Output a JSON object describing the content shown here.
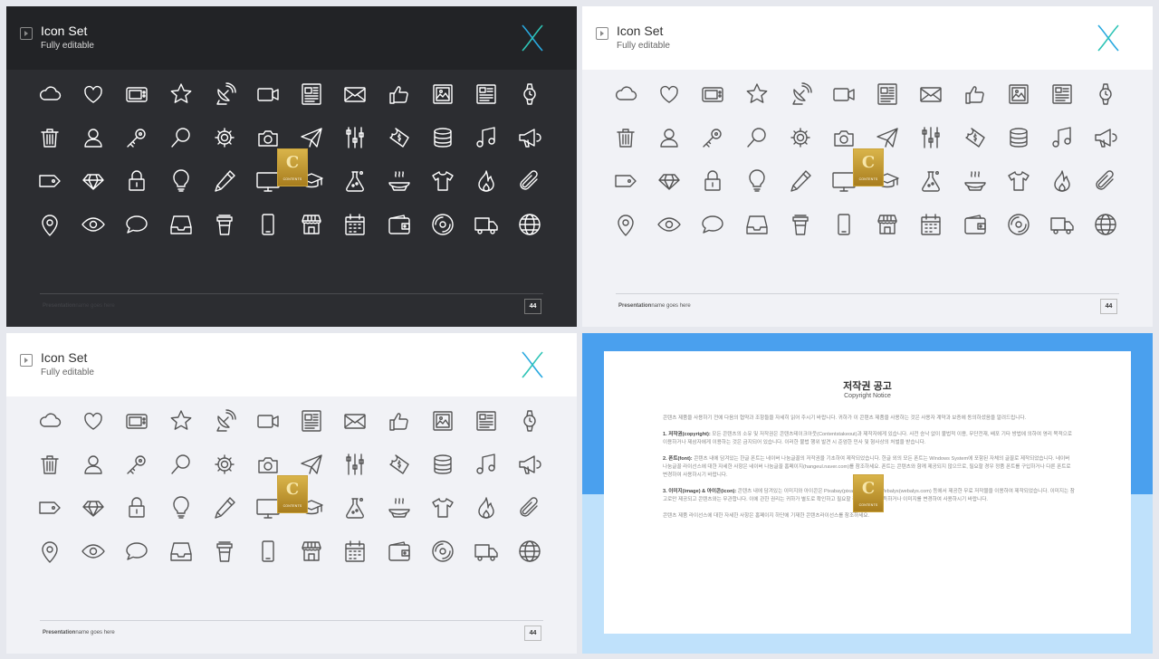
{
  "slides": [
    {
      "title": "Icon Set",
      "subtitle": "Fully editable",
      "footer_brand": "Presentation",
      "footer_rest": "name goes here",
      "page": "44"
    },
    {
      "title": "Icon Set",
      "subtitle": "Fully editable",
      "footer_brand": "Presentation",
      "footer_rest": "name goes here",
      "page": "44"
    },
    {
      "title": "Icon Set",
      "subtitle": "Fully editable",
      "footer_brand": "Presentation",
      "footer_rest": "name goes here",
      "page": "44"
    }
  ],
  "icons": [
    [
      "cloud-icon",
      "heart-icon",
      "tv-icon",
      "star-icon",
      "satellite-dish-icon",
      "video-camera-icon",
      "newspaper-icon",
      "mail-icon",
      "thumbs-up-icon",
      "picture-icon",
      "document-icon",
      "watch-icon"
    ],
    [
      "trash-icon",
      "user-icon",
      "key-icon",
      "magnifier-icon",
      "gear-icon",
      "camera-icon",
      "paper-plane-icon",
      "sliders-icon",
      "ticket-icon",
      "database-icon",
      "music-icon",
      "megaphone-icon"
    ],
    [
      "tag-icon",
      "diamond-icon",
      "lock-icon",
      "lightbulb-icon",
      "pencil-icon",
      "monitor-icon",
      "graduation-cap-icon",
      "flask-icon",
      "food-dish-icon",
      "t-shirt-icon",
      "fire-icon",
      "paperclip-icon"
    ],
    [
      "map-pin-icon",
      "eye-icon",
      "speech-bubble-icon",
      "inbox-icon",
      "coffee-cup-icon",
      "smartphone-icon",
      "store-icon",
      "calendar-icon",
      "wallet-icon",
      "disc-icon",
      "truck-icon",
      "globe-icon"
    ]
  ],
  "watermark": {
    "letter": "C",
    "text": "CONTENTS"
  },
  "copyright": {
    "title": "저작권 공고",
    "subtitle": "Copyright Notice",
    "intro": "콘텐츠 제품을 사용하기 전에 다음의 협약과 조항들을 자세히 읽어 주시기 바랍니다. 귀하가 이 콘텐츠 제품을 사용하는 것은 사용자 계약과 보증에 동의하셨음을 알려드립니다.",
    "p1_head": "1. 저작권(copyright):",
    "p1": "모든 콘텐츠의 소유 및 저작권은 콘텐츠테이크아웃(Contentstakeout)과 제작자에게 있습니다. 사전 승낙 없이 불법적 이용, 무단전재, 배포 기타 방법에 의하여 영리 목적으로 이용하거나 제삼자에게 이용하는 것은 금지되어 있습니다. 이러한 불법 행위 발견 시 준엄한 민사 및 형사상의 처벌을 받습니다.",
    "p2_head": "2. 폰트(font):",
    "p2": "콘텐츠 내에 담겨있는 한글 폰트는 네이버 나눔글꼴의 저작권을 기초하여 제작되었습니다. 한글 외의 모든 폰트는 Windows System에 포함된 자체의 글꼴로 제작되었습니다. 네이버 나눔글꼴 라이선스에 대한 자세한 사항은 네이버 나눔글꼴 홈페이지(hangeul.naver.com)를 참조하세요. 폰트는 콘텐츠와 함께 제공되지 않으므로, 필요할 경우 정품 폰트를 구입하거나 다른 폰트로 변경하여 사용하시기 바랍니다.",
    "p3_head": "3. 이미지(image) & 아이콘(icon):",
    "p3": "콘텐츠 내에 담겨있는 이미지와 아이콘은 Pixabay(pixabay.com)와 Webalys(webalys.com) 등에서 제공한 무료 저작물을 이용하여 제작되었습니다. 이미지는 참고로만 제공되고 콘텐츠와는 무관합니다. 이에 관한 권리는 귀하가 별도로 확인하고 필요할 경우 허가를 취득하거나 이미지를 변경하여 사용하시기 바랍니다.",
    "outro": "콘텐츠 제품 라이선스에 대한 자세한 사항은 홈페이지 하단에 기재한 콘텐츠라이선스를 참조하세요."
  },
  "colors": {
    "dark_bg": "#2c2d31",
    "light_bg": "#f1f2f6",
    "logo_blue": "#29a9e0",
    "logo_teal": "#2ec4b6",
    "copyright_blue": "#4aa0ee",
    "copyright_light": "#bfe1fb"
  }
}
